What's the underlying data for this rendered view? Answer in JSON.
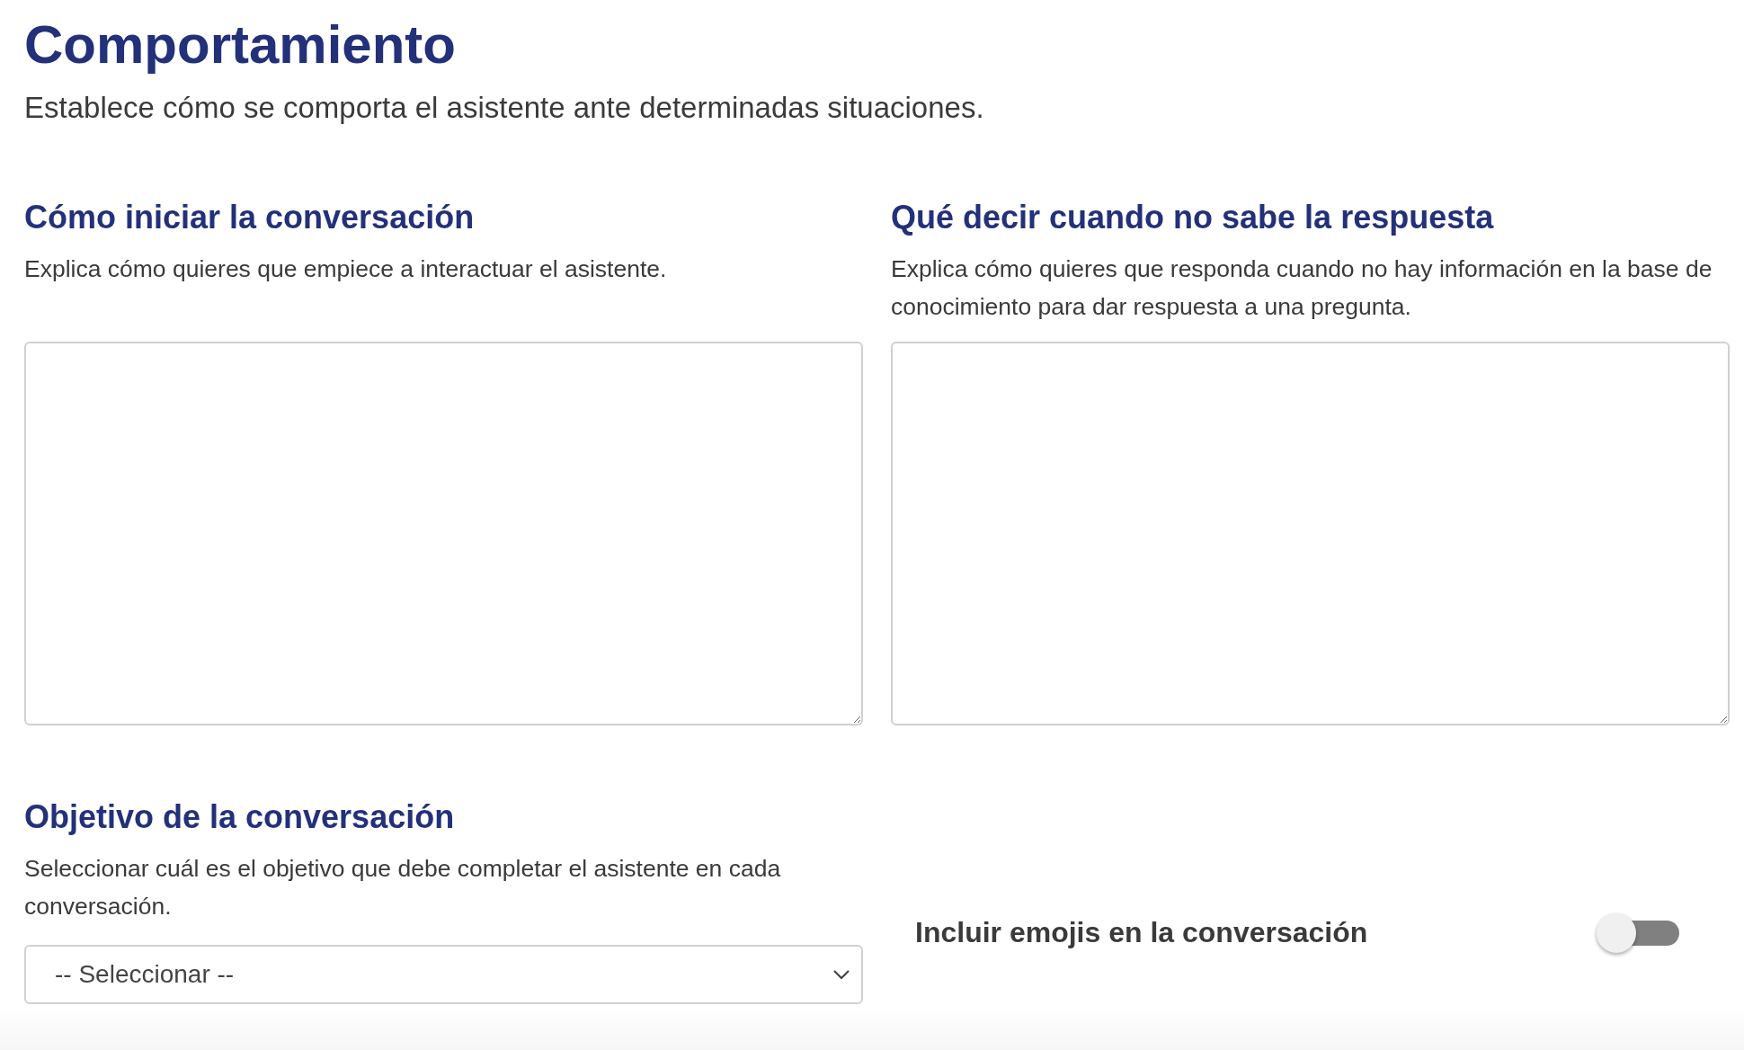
{
  "title": "Comportamiento",
  "subtitle": "Establece cómo se comporta el asistente ante determinadas situaciones.",
  "prompts": [
    {
      "heading": "Cómo iniciar la conversación",
      "description": "Explica cómo quieres que empiece a interactuar el asistente."
    },
    {
      "heading": "Qué decir cuando no sabe la respuesta",
      "description": "Explica cómo quieres que responda cuando no hay información en la base de conocimiento para dar respuesta a una pregunta."
    }
  ],
  "objective": {
    "heading": "Objetivo de la conversación",
    "description": "Seleccionar cuál es el objetivo que debe completar el asistente en cada conversación.",
    "select_value": "-- Seleccionar --"
  },
  "emoji_toggle": {
    "label": "Incluir emojis en la conversación",
    "on": false
  }
}
